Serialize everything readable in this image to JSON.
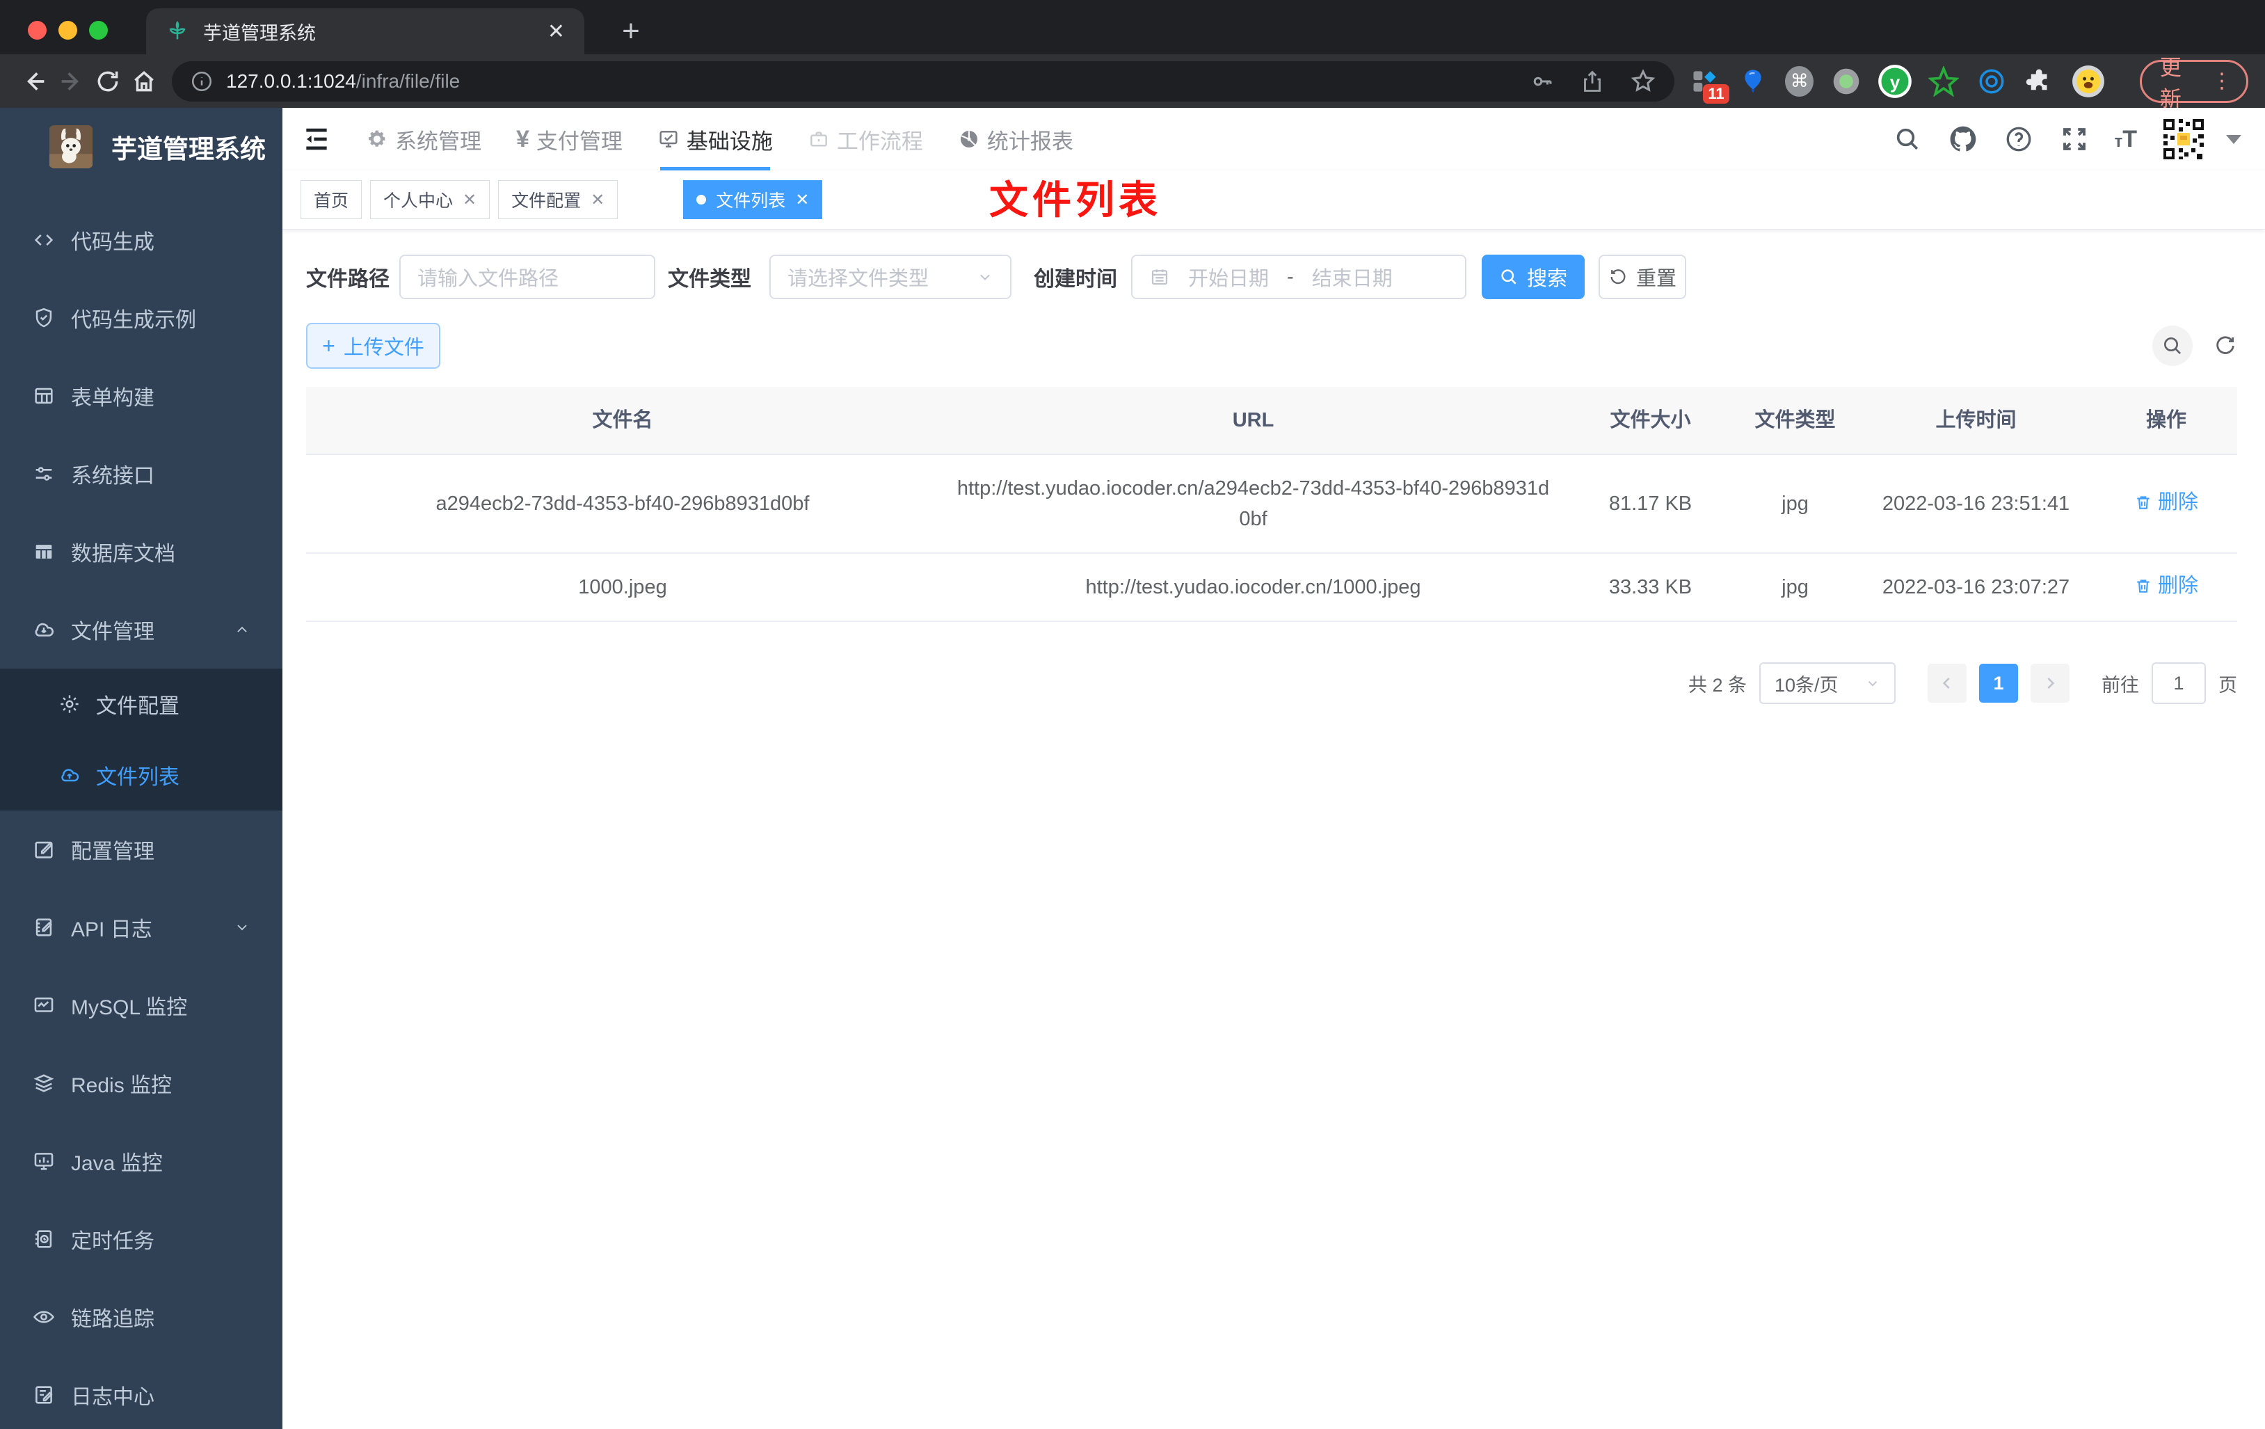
{
  "browser": {
    "tab_title": "芋道管理系统",
    "url_host": "127.0.0.1:1024",
    "url_path": "/infra/file/file",
    "extension_badge": "11",
    "update_label": "更新"
  },
  "sidebar": {
    "title": "芋道管理系统",
    "items": [
      "代码生成",
      "代码生成示例",
      "表单构建",
      "系统接口",
      "数据库文档",
      "文件管理",
      "文件配置",
      "文件列表",
      "配置管理",
      "API 日志",
      "MySQL 监控",
      "Redis 监控",
      "Java 监控",
      "定时任务",
      "链路追踪",
      "日志中心"
    ]
  },
  "topnav": {
    "items": [
      "系统管理",
      "支付管理",
      "基础设施",
      "工作流程",
      "统计报表"
    ]
  },
  "tags": {
    "items": [
      "首页",
      "个人中心",
      "文件配置",
      "文件列表"
    ]
  },
  "annotation": "文件列表",
  "filters": {
    "path_label": "文件路径",
    "path_placeholder": "请输入文件路径",
    "type_label": "文件类型",
    "type_placeholder": "请选择文件类型",
    "date_label": "创建时间",
    "date_start": "开始日期",
    "date_sep": "-",
    "date_end": "结束日期",
    "search_label": "搜索",
    "reset_label": "重置"
  },
  "toolbar": {
    "upload_label": "上传文件"
  },
  "table": {
    "headers": [
      "文件名",
      "URL",
      "文件大小",
      "文件类型",
      "上传时间",
      "操作"
    ],
    "rows": [
      {
        "name": "a294ecb2-73dd-4353-bf40-296b8931d0bf",
        "url": "http://test.yudao.iocoder.cn/a294ecb2-73dd-4353-bf40-296b8931d0bf",
        "size": "81.17 KB",
        "type": "jpg",
        "time": "2022-03-16 23:51:41",
        "action": "删除"
      },
      {
        "name": "1000.jpeg",
        "url": "http://test.yudao.iocoder.cn/1000.jpeg",
        "size": "33.33 KB",
        "type": "jpg",
        "time": "2022-03-16 23:07:27",
        "action": "删除"
      }
    ]
  },
  "pagination": {
    "total": "共 2 条",
    "page_size": "10条/页",
    "current": "1",
    "goto_label": "前往",
    "goto_value": "1",
    "unit": "页"
  },
  "colors": {
    "accent": "#409EFF",
    "sidebar_bg": "#304156",
    "submenu_bg": "#1f2d3d",
    "annotation_red": "#fa1610"
  }
}
